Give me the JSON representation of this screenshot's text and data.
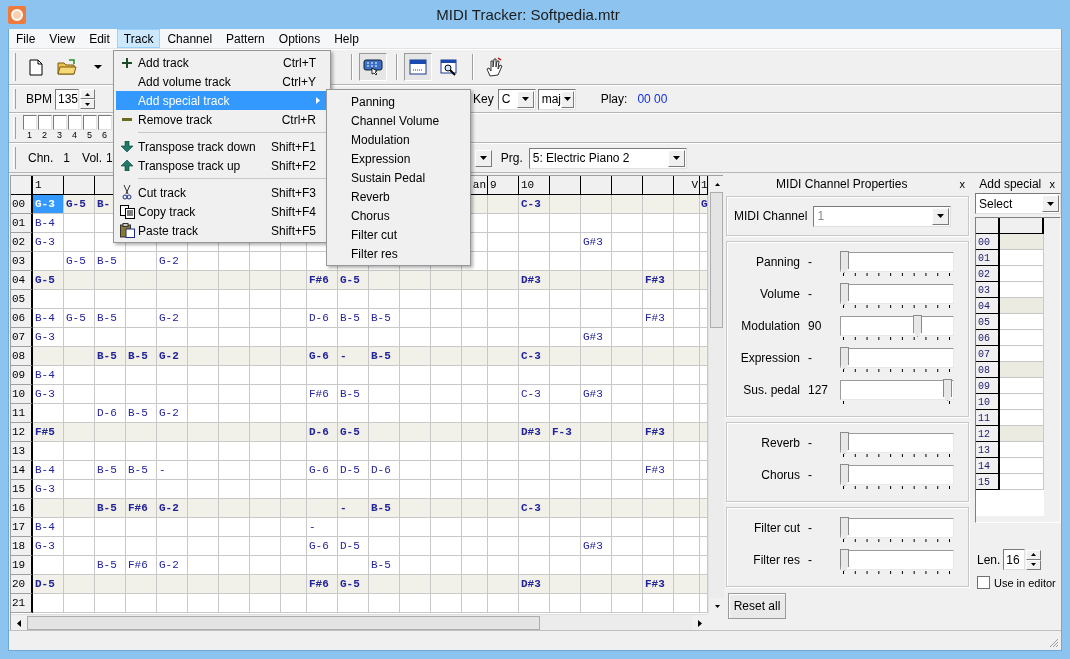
{
  "window": {
    "title": "MIDI Tracker: Softpedia.mtr"
  },
  "menu_bar": [
    {
      "label": "File",
      "selected": false
    },
    {
      "label": "View",
      "selected": false
    },
    {
      "label": "Edit",
      "selected": false
    },
    {
      "label": "Track",
      "selected": true
    },
    {
      "label": "Channel",
      "selected": false
    },
    {
      "label": "Pattern",
      "selected": false
    },
    {
      "label": "Options",
      "selected": false
    },
    {
      "label": "Help",
      "selected": false
    }
  ],
  "track_menu": {
    "items": [
      {
        "kind": "item",
        "label": "Add track",
        "shortcut": "Ctrl+T",
        "selected": false
      },
      {
        "kind": "item",
        "label": "Add volume track",
        "shortcut": "Ctrl+Y",
        "selected": false
      },
      {
        "kind": "submenu",
        "label": "Add special track",
        "selected": true
      },
      {
        "kind": "item",
        "label": "Remove track",
        "shortcut": "Ctrl+R",
        "selected": false
      },
      {
        "kind": "separator"
      },
      {
        "kind": "item",
        "label": "Transpose track down",
        "shortcut": "Shift+F1",
        "selected": false
      },
      {
        "kind": "item",
        "label": "Transpose track up",
        "shortcut": "Shift+F2",
        "selected": false
      },
      {
        "kind": "separator"
      },
      {
        "kind": "item",
        "label": "Cut track",
        "shortcut": "Shift+F3",
        "selected": false
      },
      {
        "kind": "item",
        "label": "Copy track",
        "shortcut": "Shift+F4",
        "selected": false
      },
      {
        "kind": "item",
        "label": "Paste track",
        "shortcut": "Shift+F5",
        "selected": false
      }
    ]
  },
  "special_submenu": {
    "items": [
      "Panning",
      "Channel Volume",
      "Modulation",
      "Expression",
      "Sustain Pedal",
      "Reverb",
      "Chorus",
      "Filter cut",
      "Filter res"
    ]
  },
  "toolbar": {
    "buttons": [
      {
        "pressed": false
      },
      {
        "pressed": false
      },
      {
        "pressed": false
      },
      {
        "pressed": true
      },
      {
        "pressed": true
      },
      {
        "pressed": false
      },
      {
        "pressed": false
      }
    ]
  },
  "tempo_bar": {
    "bpm_label": "BPM",
    "bpm": "135",
    "key_label": "Key",
    "key": "C",
    "scale": "maj",
    "play_label": "Play:",
    "play_position": "00 00"
  },
  "mute_bar": {
    "tracks": [
      {
        "label": "1",
        "checked": false
      },
      {
        "label": "2",
        "checked": false
      },
      {
        "label": "3",
        "checked": false
      },
      {
        "label": "4",
        "checked": false
      },
      {
        "label": "5",
        "checked": false
      },
      {
        "label": "6",
        "checked": false
      }
    ]
  },
  "channel_bar": {
    "channel_label": "Chn.",
    "channel": "1",
    "volume_label": "Vol.",
    "volume": "1",
    "program_label": "Prg.",
    "program": "5: Electric Piano 2"
  },
  "pattern": {
    "columns": [
      {
        "kind": "note",
        "label": "1"
      },
      {
        "kind": "note"
      },
      {
        "kind": "note"
      },
      {
        "kind": "note"
      },
      {
        "kind": "note"
      },
      {
        "kind": "note"
      },
      {
        "kind": "note"
      },
      {
        "kind": "note"
      },
      {
        "kind": "special"
      },
      {
        "kind": "note"
      },
      {
        "kind": "note"
      },
      {
        "kind": "note"
      },
      {
        "kind": "note"
      },
      {
        "kind": "note"
      },
      {
        "kind": "special",
        "label": "an"
      },
      {
        "kind": "note",
        "label": "9"
      },
      {
        "kind": "note",
        "label": "10"
      },
      {
        "kind": "note"
      },
      {
        "kind": "note"
      },
      {
        "kind": "note"
      },
      {
        "kind": "note"
      },
      {
        "kind": "special",
        "label": "V"
      },
      {
        "kind": "cut",
        "label": "1"
      }
    ],
    "rows": [
      {
        "label": "00",
        "beat": true,
        "cells": [
          {
            "note": "G-3",
            "selected": true
          },
          {
            "note": "G-5",
            "selected": false
          },
          {
            "note": "B-",
            "selected": false
          },
          null,
          null,
          null,
          null,
          null,
          null,
          null,
          null,
          null,
          null,
          null,
          null,
          null,
          {
            "note": "C-3",
            "selected": false
          },
          null,
          null,
          null,
          null,
          null,
          {
            "note": "G",
            "selected": false
          }
        ]
      },
      {
        "label": "01",
        "beat": false,
        "cells": [
          {
            "note": "B-4",
            "selected": false
          }
        ]
      },
      {
        "label": "02",
        "beat": false,
        "cells": [
          {
            "note": "G-3",
            "selected": false
          },
          null,
          null,
          null,
          null,
          null,
          null,
          null,
          null,
          null,
          null,
          null,
          null,
          null,
          null,
          null,
          null,
          null,
          {
            "note": "G#3",
            "selected": false
          }
        ]
      },
      {
        "label": "03",
        "beat": false,
        "cells": [
          null,
          {
            "note": "G-5",
            "selected": false
          },
          {
            "note": "B-5",
            "selected": false
          },
          null,
          {
            "note": "G-2",
            "selected": false
          }
        ]
      },
      {
        "label": "04",
        "beat": true,
        "cells": [
          {
            "note": "G-5",
            "selected": false
          },
          null,
          null,
          null,
          null,
          null,
          null,
          null,
          null,
          {
            "note": "F#6",
            "selected": false
          },
          {
            "note": "G-5",
            "selected": false
          },
          null,
          null,
          null,
          null,
          null,
          {
            "note": "D#3",
            "selected": false
          },
          null,
          null,
          null,
          {
            "note": "F#3",
            "selected": false
          }
        ]
      },
      {
        "label": "05",
        "beat": false,
        "cells": []
      },
      {
        "label": "06",
        "beat": false,
        "cells": [
          {
            "note": "B-4",
            "selected": false
          },
          {
            "note": "G-5",
            "selected": false
          },
          {
            "note": "B-5",
            "selected": false
          },
          null,
          {
            "note": "G-2",
            "selected": false
          },
          null,
          null,
          null,
          null,
          {
            "note": "D-6",
            "selected": false
          },
          {
            "note": "B-5",
            "selected": false
          },
          {
            "note": "B-5",
            "selected": false
          },
          null,
          null,
          null,
          null,
          null,
          null,
          null,
          null,
          {
            "note": "F#3",
            "selected": false
          }
        ]
      },
      {
        "label": "07",
        "beat": false,
        "cells": [
          {
            "note": "G-3",
            "selected": false
          },
          null,
          null,
          null,
          null,
          null,
          null,
          null,
          null,
          null,
          null,
          null,
          null,
          null,
          null,
          null,
          null,
          null,
          {
            "note": "G#3",
            "selected": false
          }
        ]
      },
      {
        "label": "08",
        "beat": true,
        "cells": [
          null,
          null,
          {
            "note": "B-5",
            "selected": false
          },
          {
            "note": "B-5",
            "selected": false
          },
          {
            "note": "G-2",
            "selected": false
          },
          null,
          null,
          null,
          null,
          {
            "note": "G-6",
            "selected": false
          },
          {
            "note": "-",
            "selected": false
          },
          {
            "note": "B-5",
            "selected": false
          },
          null,
          null,
          null,
          null,
          {
            "note": "C-3",
            "selected": false
          }
        ]
      },
      {
        "label": "09",
        "beat": false,
        "cells": [
          {
            "note": "B-4",
            "selected": false
          }
        ]
      },
      {
        "label": "10",
        "beat": false,
        "cells": [
          {
            "note": "G-3",
            "selected": false
          },
          null,
          null,
          null,
          null,
          null,
          null,
          null,
          null,
          {
            "note": "F#6",
            "selected": false
          },
          {
            "note": "B-5",
            "selected": false
          },
          null,
          null,
          null,
          null,
          null,
          {
            "note": "C-3",
            "selected": false
          },
          null,
          {
            "note": "G#3",
            "selected": false
          }
        ]
      },
      {
        "label": "11",
        "beat": false,
        "cells": [
          null,
          null,
          {
            "note": "D-6",
            "selected": false
          },
          {
            "note": "B-5",
            "selected": false
          },
          {
            "note": "G-2",
            "selected": false
          }
        ]
      },
      {
        "label": "12",
        "beat": true,
        "cells": [
          {
            "note": "F#5",
            "selected": false
          },
          null,
          null,
          null,
          null,
          null,
          null,
          null,
          null,
          {
            "note": "D-6",
            "selected": false
          },
          {
            "note": "G-5",
            "selected": false
          },
          null,
          null,
          null,
          null,
          null,
          {
            "note": "D#3",
            "selected": false
          },
          {
            "note": "F-3",
            "selected": false
          },
          null,
          null,
          {
            "note": "F#3",
            "selected": false
          }
        ]
      },
      {
        "label": "13",
        "beat": false,
        "cells": []
      },
      {
        "label": "14",
        "beat": false,
        "cells": [
          {
            "note": "B-4",
            "selected": false
          },
          null,
          {
            "note": "B-5",
            "selected": false
          },
          {
            "note": "B-5",
            "selected": false
          },
          {
            "note": "-",
            "selected": false
          },
          null,
          null,
          null,
          null,
          {
            "note": "G-6",
            "selected": false
          },
          {
            "note": "D-5",
            "selected": false
          },
          {
            "note": "D-6",
            "selected": false
          },
          null,
          null,
          null,
          null,
          null,
          null,
          null,
          null,
          {
            "note": "F#3",
            "selected": false
          }
        ]
      },
      {
        "label": "15",
        "beat": false,
        "cells": [
          {
            "note": "G-3",
            "selected": false
          }
        ]
      },
      {
        "label": "16",
        "beat": true,
        "cells": [
          null,
          null,
          {
            "note": "B-5",
            "selected": false
          },
          {
            "note": "F#6",
            "selected": false
          },
          {
            "note": "G-2",
            "selected": false
          },
          null,
          null,
          null,
          null,
          null,
          {
            "note": "-",
            "selected": false
          },
          {
            "note": "B-5",
            "selected": false
          },
          null,
          null,
          null,
          null,
          {
            "note": "C-3",
            "selected": false
          }
        ]
      },
      {
        "label": "17",
        "beat": false,
        "cells": [
          {
            "note": "B-4",
            "selected": false
          },
          null,
          null,
          null,
          null,
          null,
          null,
          null,
          null,
          {
            "note": "-",
            "selected": false
          }
        ]
      },
      {
        "label": "18",
        "beat": false,
        "cells": [
          {
            "note": "G-3",
            "selected": false
          },
          null,
          null,
          null,
          null,
          null,
          null,
          null,
          null,
          {
            "note": "G-6",
            "selected": false
          },
          {
            "note": "D-5",
            "selected": false
          },
          null,
          null,
          null,
          null,
          null,
          null,
          null,
          {
            "note": "G#3",
            "selected": false
          }
        ]
      },
      {
        "label": "19",
        "beat": false,
        "cells": [
          null,
          null,
          {
            "note": "B-5",
            "selected": false
          },
          {
            "note": "F#6",
            "selected": false
          },
          {
            "note": "G-2",
            "selected": false
          },
          null,
          null,
          null,
          null,
          null,
          null,
          {
            "note": "B-5",
            "selected": false
          }
        ]
      },
      {
        "label": "20",
        "beat": true,
        "cells": [
          {
            "note": "D-5",
            "selected": false
          },
          null,
          null,
          null,
          null,
          null,
          null,
          null,
          null,
          {
            "note": "F#6",
            "selected": false
          },
          {
            "note": "G-5",
            "selected": false
          },
          null,
          null,
          null,
          null,
          null,
          {
            "note": "D#3",
            "selected": false
          },
          null,
          null,
          null,
          {
            "note": "F#3",
            "selected": false
          }
        ]
      },
      {
        "label": "21",
        "beat": false,
        "cells": []
      }
    ]
  },
  "channel_properties": {
    "title": "MIDI Channel Properties",
    "close": "x",
    "channel_label": "MIDI Channel",
    "channel": "1",
    "channel_disabled": true,
    "groups": [
      {
        "sliders": [
          {
            "kind": "range",
            "label": "Panning",
            "reading": "-",
            "level": 0
          },
          {
            "kind": "range",
            "label": "Volume",
            "reading": "-",
            "level": 0
          },
          {
            "kind": "range",
            "label": "Modulation",
            "reading": "90",
            "level": 0.71
          },
          {
            "kind": "range",
            "label": "Expression",
            "reading": "-",
            "level": 0
          },
          {
            "kind": "toggle",
            "label": "Sus. pedal",
            "reading": "127",
            "level": 1
          }
        ]
      },
      {
        "sliders": [
          {
            "kind": "range",
            "label": "Reverb",
            "reading": "-",
            "level": 0
          },
          {
            "kind": "range",
            "label": "Chorus",
            "reading": "-",
            "level": 0
          }
        ]
      },
      {
        "sliders": [
          {
            "kind": "range",
            "label": "Filter cut",
            "reading": "-",
            "level": 0
          },
          {
            "kind": "range",
            "label": "Filter res",
            "reading": "-",
            "level": 0
          }
        ]
      }
    ],
    "reset_button": "Reset all"
  },
  "add_special": {
    "title": "Add special",
    "close": "x",
    "select": "Select",
    "rows": [
      {
        "label": "00",
        "beat": true
      },
      {
        "label": "01",
        "beat": false
      },
      {
        "label": "02",
        "beat": false
      },
      {
        "label": "03",
        "beat": false
      },
      {
        "label": "04",
        "beat": true
      },
      {
        "label": "05",
        "beat": false
      },
      {
        "label": "06",
        "beat": false
      },
      {
        "label": "07",
        "beat": false
      },
      {
        "label": "08",
        "beat": true
      },
      {
        "label": "09",
        "beat": false
      },
      {
        "label": "10",
        "beat": false
      },
      {
        "label": "11",
        "beat": false
      },
      {
        "label": "12",
        "beat": true
      },
      {
        "label": "13",
        "beat": false
      },
      {
        "label": "14",
        "beat": false
      },
      {
        "label": "15",
        "beat": false
      }
    ],
    "length_label": "Len.",
    "length": "16",
    "use_in_editor": {
      "label": "Use in editor",
      "checked": false
    }
  }
}
